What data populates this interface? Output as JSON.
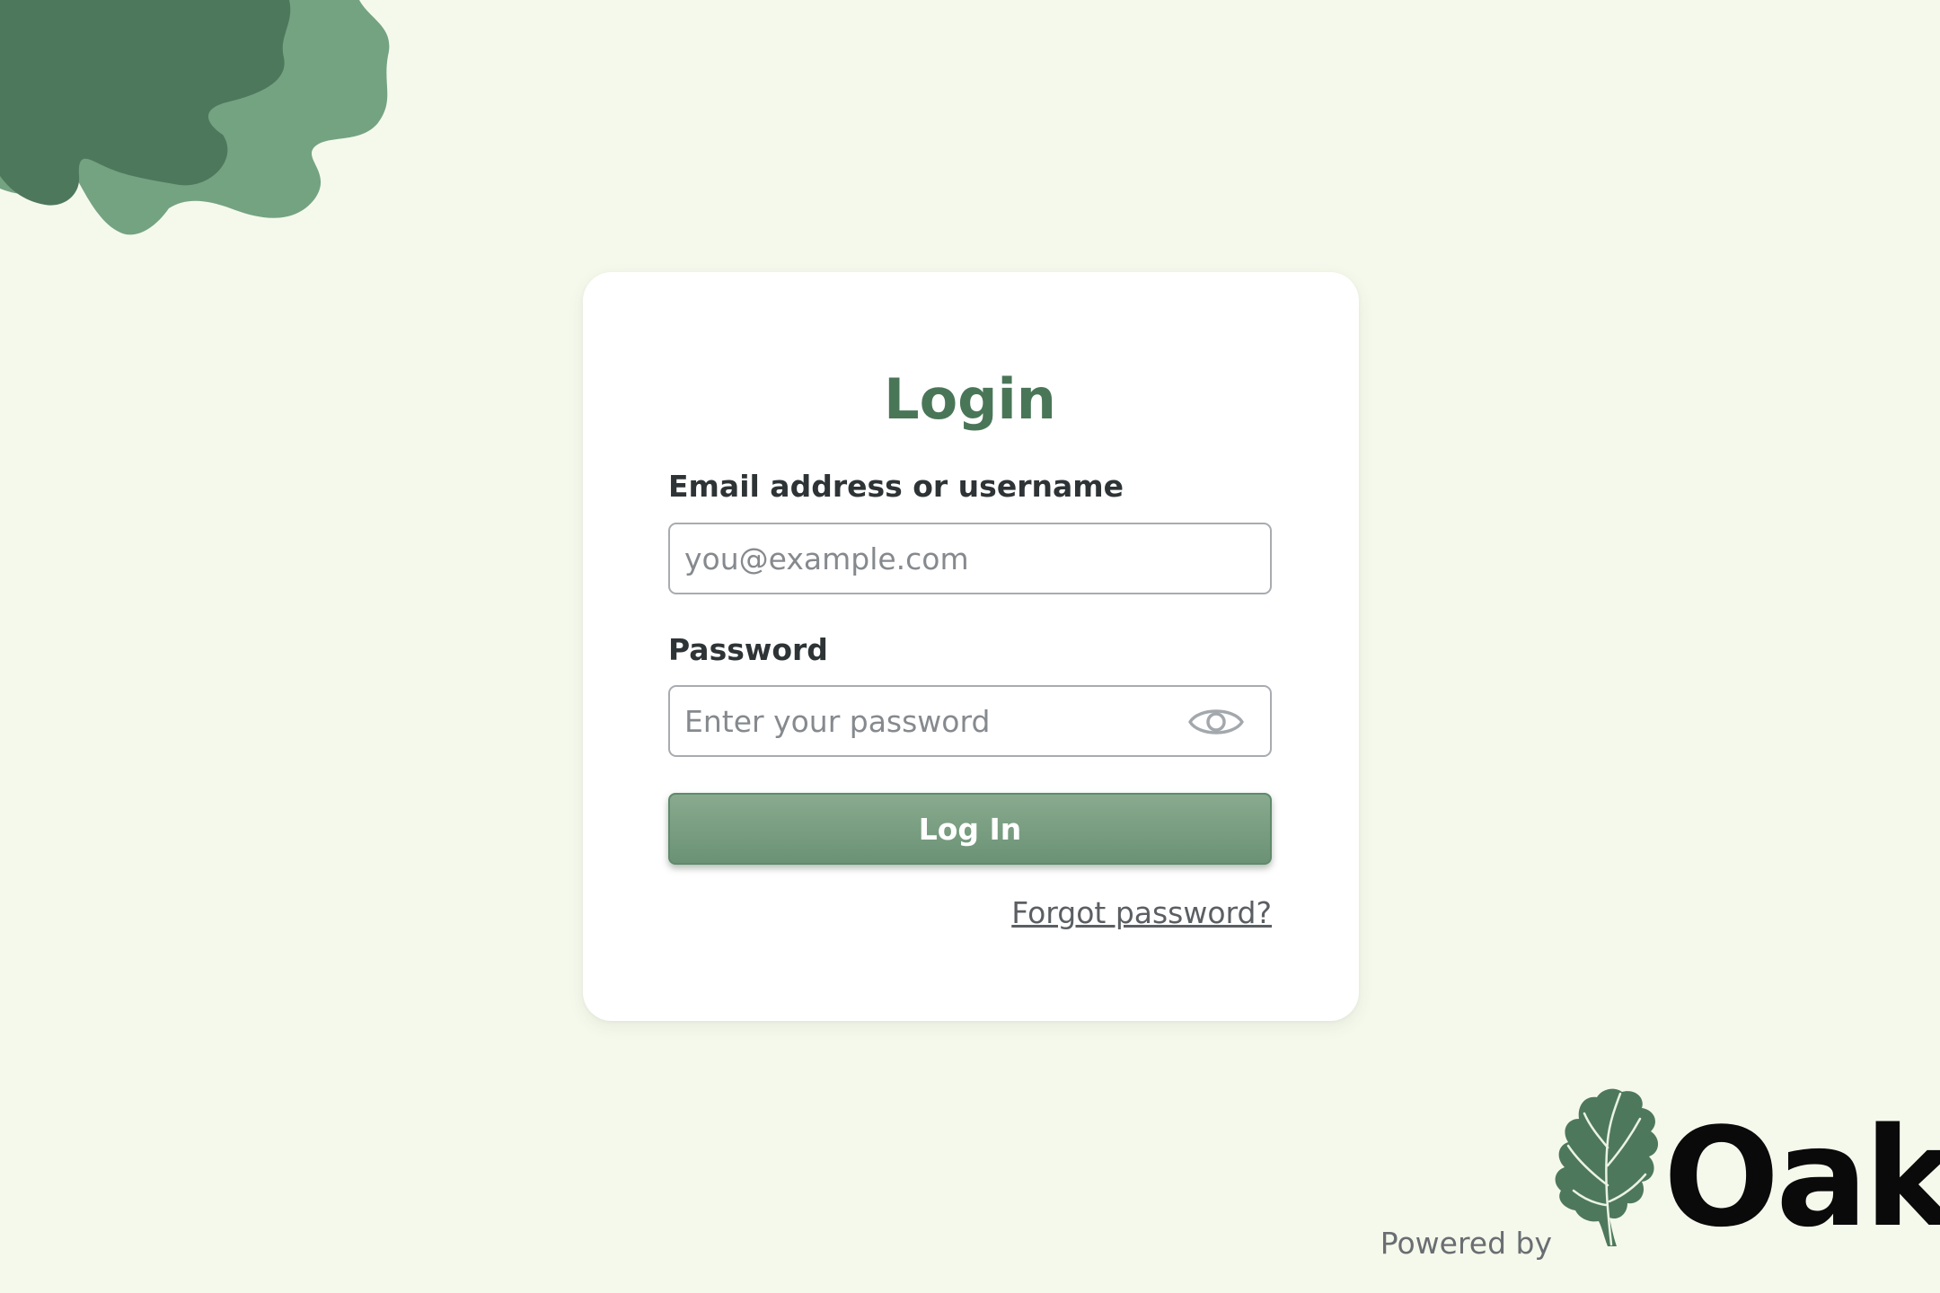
{
  "login": {
    "title": "Login",
    "email_label": "Email address or username",
    "email_placeholder": "you@example.com",
    "password_label": "Password",
    "password_placeholder": "Enter your password",
    "submit_label": "Log In",
    "forgot_link": "Forgot password?"
  },
  "footer": {
    "powered_by": "Powered by",
    "brand": "Oak"
  },
  "icons": {
    "password_toggle": "eye-icon",
    "brand_mark": "oak-leaf-icon"
  },
  "colors": {
    "background": "#f5f9ec",
    "accent": "#4a7658",
    "button": "#6b9275",
    "blob_dark": "#4e785c",
    "blob_light": "#74a381"
  }
}
